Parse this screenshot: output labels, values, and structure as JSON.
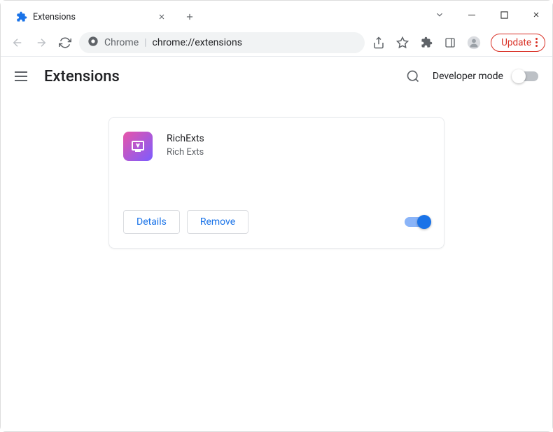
{
  "window": {
    "tab_title": "Extensions"
  },
  "toolbar": {
    "omnibox_scheme": "Chrome",
    "omnibox_url": "chrome://extensions",
    "update_label": "Update"
  },
  "page": {
    "title": "Extensions",
    "dev_mode_label": "Developer mode"
  },
  "extension": {
    "name": "RichExts",
    "description": "Rich Exts",
    "details_label": "Details",
    "remove_label": "Remove"
  }
}
